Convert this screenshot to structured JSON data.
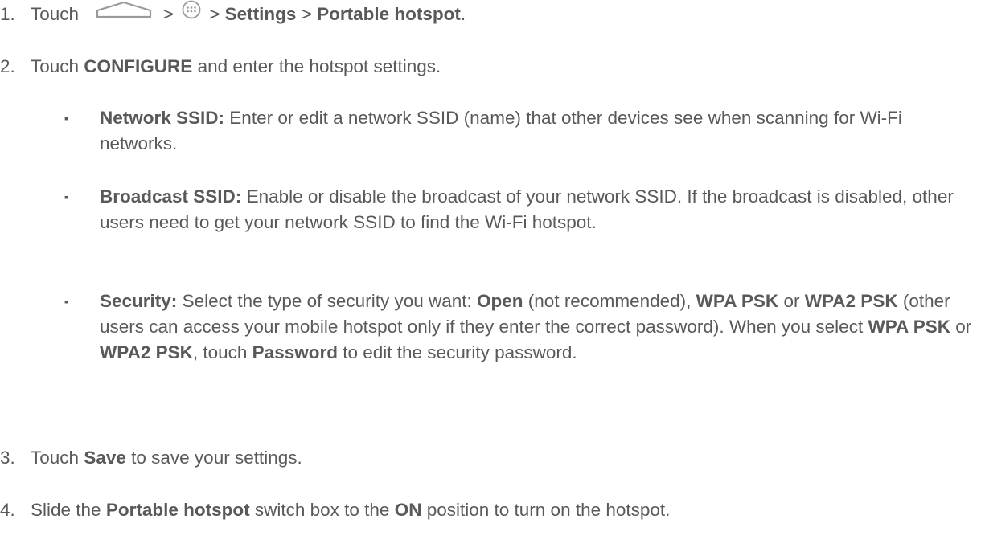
{
  "steps": [
    {
      "num": "1.",
      "touch": "Touch",
      "sep1": ">",
      "sep2": ">",
      "settings": "Settings",
      "sep3": ">",
      "hotspot": "Portable hotspot",
      "end": "."
    },
    {
      "num": "2.",
      "touch": "Touch",
      "configure": "CONFIGURE",
      "rest": "and enter the hotspot settings."
    },
    {
      "num": "3.",
      "touch": "Touch",
      "save": "Save",
      "rest": "to save your settings."
    },
    {
      "num": "4.",
      "slide": "Slide the",
      "hotspot": "Portable hotspot",
      "mid": "switch box to the",
      "on": "ON",
      "rest": "position to turn on the hotspot."
    }
  ],
  "bullets": {
    "marker": "▪",
    "ssid": {
      "label": "Network SSID:",
      "text": "Enter or edit a network SSID (name) that other devices see when scanning for Wi-Fi networks."
    },
    "broadcast": {
      "label": "Broadcast SSID:",
      "text": "Enable or disable the broadcast of your network SSID. If the broadcast is disabled, other users need to get your network SSID to find the Wi-Fi hotspot."
    },
    "security": {
      "label": "Security:",
      "t1": "Select the type of security you want:",
      "open": "Open",
      "t2": "(not recommended),",
      "wpa": "WPA PSK",
      "t3": "or",
      "wpa2": "WPA2 PSK",
      "t4": "(other users can access your mobile hotspot only if they enter the correct password). When you select",
      "wpa_b": "WPA PSK",
      "t5": "or",
      "wpa2_b": "WPA2 PSK",
      "t6": ", touch",
      "password": "Password",
      "t7": "to edit the security password."
    }
  },
  "icons": {
    "home": "home-icon",
    "apps": "apps-icon"
  }
}
